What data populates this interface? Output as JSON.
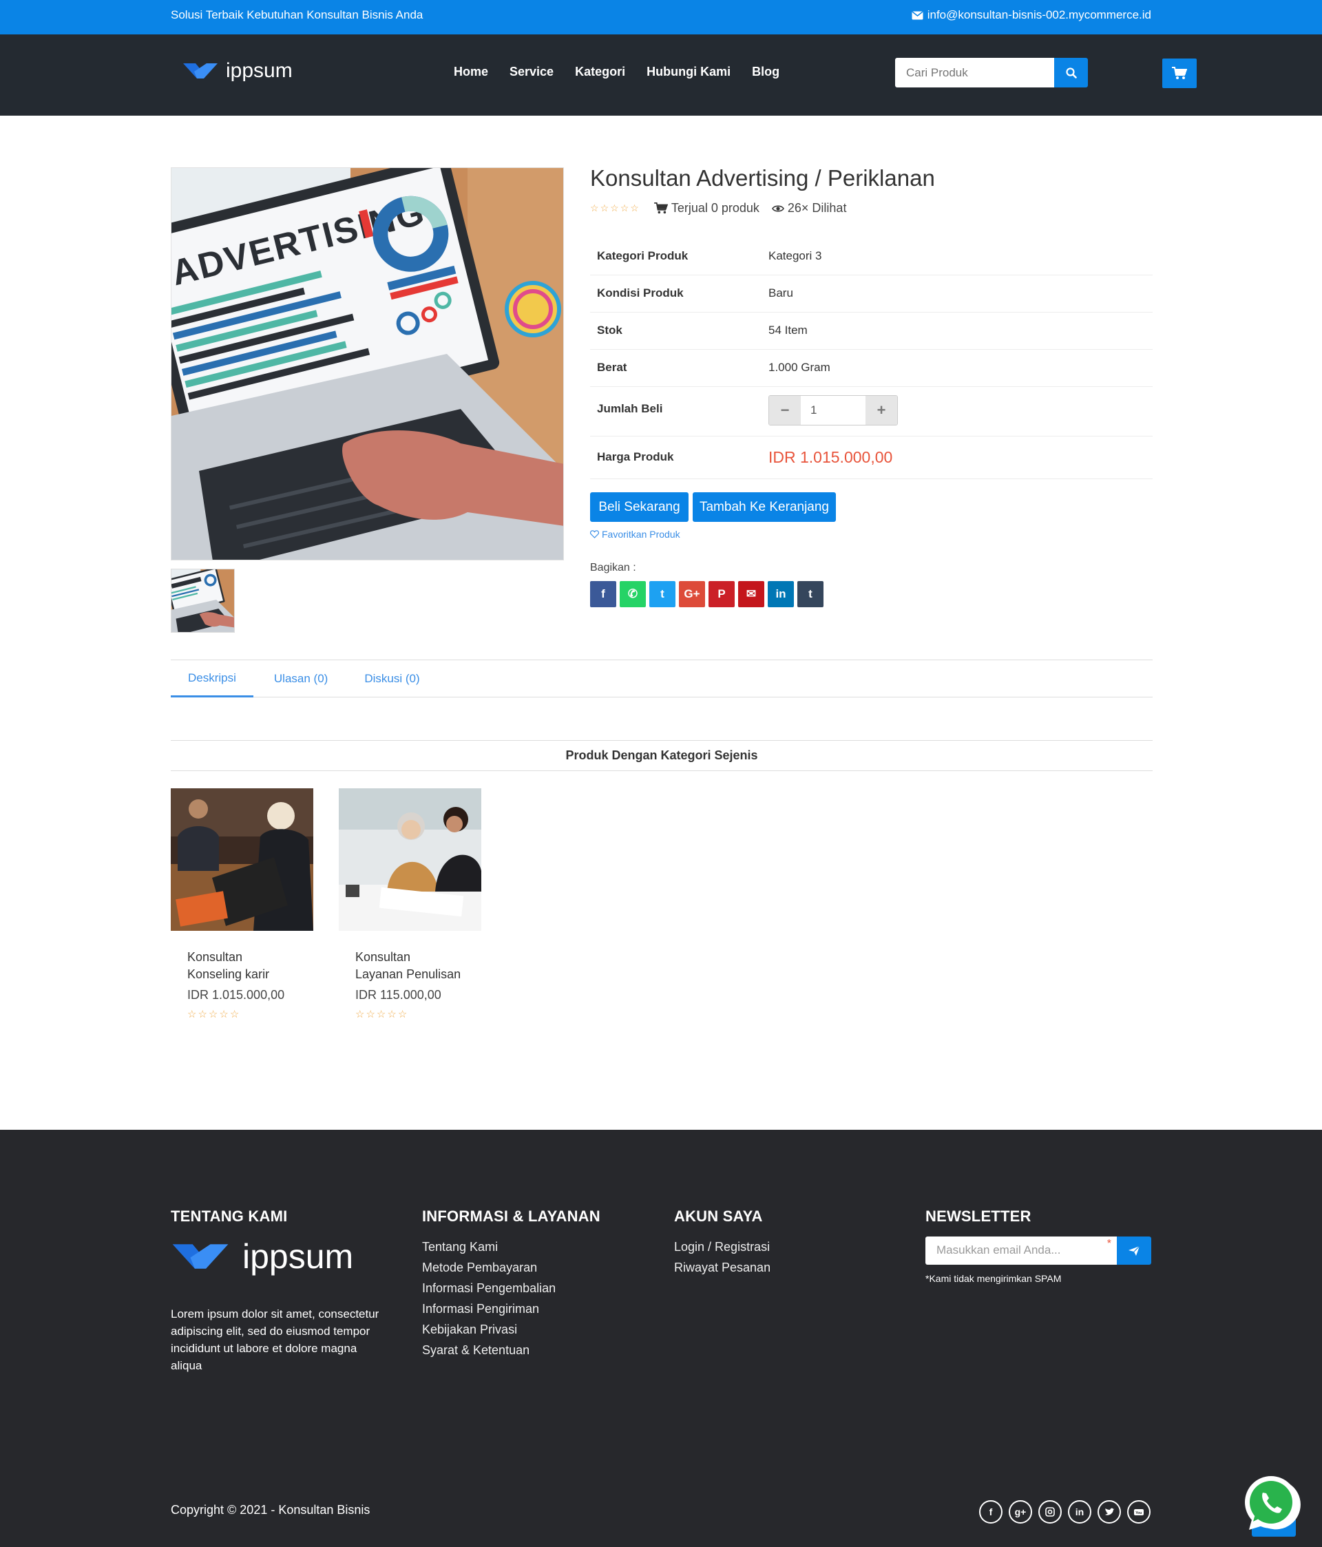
{
  "topbar": {
    "tagline": "Solusi Terbaik Kebutuhan Konsultan Bisnis Anda",
    "email": "info@konsultan-bisnis-002.mycommerce.id"
  },
  "header": {
    "logo_text": "ippsum",
    "nav": [
      "Home",
      "Service",
      "Kategori",
      "Hubungi Kami",
      "Blog"
    ],
    "search_placeholder": "Cari Produk"
  },
  "product": {
    "title": "Konsultan Advertising / Periklanan",
    "image_text": "ADVERTISING",
    "sold": "Terjual 0 produk",
    "views": "26× Dilihat",
    "specs": [
      {
        "label": "Kategori Produk",
        "value": "Kategori 3"
      },
      {
        "label": "Kondisi Produk",
        "value": "Baru"
      },
      {
        "label": "Stok",
        "value": "54 Item"
      },
      {
        "label": "Berat",
        "value": "1.000 Gram"
      }
    ],
    "quantity_label": "Jumlah Beli",
    "quantity_value": "1",
    "price_label": "Harga Produk",
    "price": "IDR 1.015.000,00",
    "buy_now": "Beli Sekarang",
    "add_to_cart": "Tambah Ke Keranjang",
    "favorite": "Favoritkan Produk",
    "share_label": "Bagikan :",
    "share_buttons": [
      {
        "name": "facebook",
        "glyph": "f",
        "color": "#3b5998"
      },
      {
        "name": "whatsapp",
        "glyph": "✆",
        "color": "#25d366"
      },
      {
        "name": "twitter",
        "glyph": "t",
        "color": "#1da1f2"
      },
      {
        "name": "google-plus",
        "glyph": "G+",
        "color": "#dd4b39"
      },
      {
        "name": "pinterest",
        "glyph": "P",
        "color": "#cb2027"
      },
      {
        "name": "email",
        "glyph": "✉",
        "color": "#c4161c"
      },
      {
        "name": "linkedin",
        "glyph": "in",
        "color": "#0077b5"
      },
      {
        "name": "tumblr",
        "glyph": "t",
        "color": "#35465c"
      }
    ]
  },
  "tabs": [
    "Deskripsi",
    "Ulasan (0)",
    "Diskusi (0)"
  ],
  "related": {
    "title": "Produk Dengan Kategori Sejenis",
    "items": [
      {
        "line1": "Konsultan",
        "line2": "Konseling karir",
        "price": "IDR 1.015.000,00"
      },
      {
        "line1": "Konsultan",
        "line2": "Layanan Penulisan",
        "price": "IDR 115.000,00"
      }
    ]
  },
  "footer": {
    "about_title": "TENTANG KAMI",
    "logo_text": "ippsum",
    "about_text": "Lorem ipsum dolor sit amet, consectetur adipiscing elit, sed do eiusmod tempor incididunt ut labore et dolore magna aliqua",
    "info_title": "INFORMASI & LAYANAN",
    "info_links": [
      "Tentang Kami",
      "Metode Pembayaran",
      "Informasi Pengembalian",
      "Informasi Pengiriman",
      "Kebijakan Privasi",
      "Syarat & Ketentuan"
    ],
    "account_title": "AKUN SAYA",
    "account_links": [
      "Login / Registrasi",
      "Riwayat Pesanan"
    ],
    "newsletter_title": "NEWSLETTER",
    "newsletter_placeholder": "Masukkan email Anda...",
    "newsletter_note": "*Kami tidak mengirimkan SPAM",
    "copyright": "Copyright © 2021 - Konsultan Bisnis"
  },
  "colors": {
    "primary": "#0a84e6",
    "header_bg": "#242a31",
    "footer_bg": "#27282c",
    "price": "#e8543b"
  }
}
